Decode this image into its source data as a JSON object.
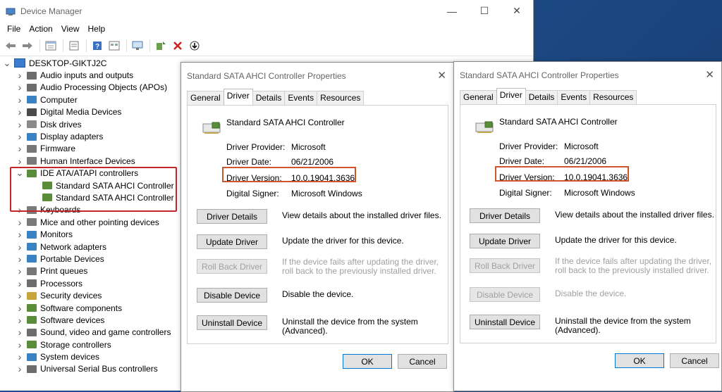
{
  "window": {
    "title": "Device Manager",
    "minimize": "—",
    "maximize": "☐",
    "close": "✕"
  },
  "menu": [
    "File",
    "Action",
    "View",
    "Help"
  ],
  "tree": {
    "root": "DESKTOP-GIKTJ2C",
    "items": [
      {
        "label": "Audio inputs and outputs",
        "expanded": false,
        "color": "#6d6d6d"
      },
      {
        "label": "Audio Processing Objects (APOs)",
        "expanded": false,
        "color": "#6d6d6d"
      },
      {
        "label": "Computer",
        "expanded": false,
        "color": "#3b82c4"
      },
      {
        "label": "Digital Media Devices",
        "expanded": false,
        "color": "#4a4a4a"
      },
      {
        "label": "Disk drives",
        "expanded": false,
        "color": "#8a8a8a"
      },
      {
        "label": "Display adapters",
        "expanded": false,
        "color": "#3b82c4"
      },
      {
        "label": "Firmware",
        "expanded": false,
        "color": "#777777"
      },
      {
        "label": "Human Interface Devices",
        "expanded": false,
        "color": "#7a7a7a"
      },
      {
        "label": "IDE ATA/ATAPI controllers",
        "expanded": true,
        "color": "#5a8d3a",
        "children": [
          "Standard SATA AHCI Controller",
          "Standard SATA AHCI Controller"
        ]
      },
      {
        "label": "Keyboards",
        "expanded": false,
        "color": "#7a7a7a"
      },
      {
        "label": "Mice and other pointing devices",
        "expanded": false,
        "color": "#7a7a7a"
      },
      {
        "label": "Monitors",
        "expanded": false,
        "color": "#3b82c4"
      },
      {
        "label": "Network adapters",
        "expanded": false,
        "color": "#3b82c4"
      },
      {
        "label": "Portable Devices",
        "expanded": false,
        "color": "#3b82c4"
      },
      {
        "label": "Print queues",
        "expanded": false,
        "color": "#777777"
      },
      {
        "label": "Processors",
        "expanded": false,
        "color": "#6d6d6d"
      },
      {
        "label": "Security devices",
        "expanded": false,
        "color": "#c6a43a"
      },
      {
        "label": "Software components",
        "expanded": false,
        "color": "#5a8d3a"
      },
      {
        "label": "Software devices",
        "expanded": false,
        "color": "#5a8d3a"
      },
      {
        "label": "Sound, video and game controllers",
        "expanded": false,
        "color": "#6d6d6d"
      },
      {
        "label": "Storage controllers",
        "expanded": false,
        "color": "#5a8d3a"
      },
      {
        "label": "System devices",
        "expanded": false,
        "color": "#3b82c4"
      },
      {
        "label": "Universal Serial Bus controllers",
        "expanded": false,
        "color": "#6d6d6d"
      }
    ]
  },
  "dialogs": [
    {
      "title": "Standard SATA AHCI Controller Properties",
      "close": "✕",
      "tabs": [
        "General",
        "Driver",
        "Details",
        "Events",
        "Resources"
      ],
      "active_tab": "Driver",
      "device_name": "Standard SATA AHCI Controller",
      "fields": [
        {
          "key": "Driver Provider:",
          "value": "Microsoft"
        },
        {
          "key": "Driver Date:",
          "value": "06/21/2006"
        },
        {
          "key": "Driver Version:",
          "value": "10.0.19041.3636"
        },
        {
          "key": "Digital Signer:",
          "value": "Microsoft Windows"
        }
      ],
      "actions": [
        {
          "button": "Driver Details",
          "desc": "View details about the installed driver files.",
          "disabled": false
        },
        {
          "button": "Update Driver",
          "desc": "Update the driver for this device.",
          "disabled": false
        },
        {
          "button": "Roll Back Driver",
          "desc": "If the device fails after updating the driver, roll back to the previously installed driver.",
          "disabled": true
        },
        {
          "button": "Disable Device",
          "desc": "Disable the device.",
          "disabled": false
        },
        {
          "button": "Uninstall Device",
          "desc": "Uninstall the device from the system (Advanced).",
          "disabled": false
        }
      ],
      "ok": "OK",
      "cancel": "Cancel"
    },
    {
      "title": "Standard SATA AHCI Controller Properties",
      "close": "✕",
      "tabs": [
        "General",
        "Driver",
        "Details",
        "Events",
        "Resources"
      ],
      "active_tab": "Driver",
      "device_name": "Standard SATA AHCI Controller",
      "fields": [
        {
          "key": "Driver Provider:",
          "value": "Microsoft"
        },
        {
          "key": "Driver Date:",
          "value": "06/21/2006"
        },
        {
          "key": "Driver Version:",
          "value": "10.0.19041.3636"
        },
        {
          "key": "Digital Signer:",
          "value": "Microsoft Windows"
        }
      ],
      "actions": [
        {
          "button": "Driver Details",
          "desc": "View details about the installed driver files.",
          "disabled": false
        },
        {
          "button": "Update Driver",
          "desc": "Update the driver for this device.",
          "disabled": false
        },
        {
          "button": "Roll Back Driver",
          "desc": "If the device fails after updating the driver, roll back to the previously installed driver.",
          "disabled": true
        },
        {
          "button": "Disable Device",
          "desc": "Disable the device.",
          "disabled": true
        },
        {
          "button": "Uninstall Device",
          "desc": "Uninstall the device from the system (Advanced).",
          "disabled": false
        }
      ],
      "ok": "OK",
      "cancel": "Cancel"
    }
  ],
  "colors": {
    "highlight_red": "#c4262b",
    "highlight_orange": "#d0552d",
    "accent": "#0078d7"
  }
}
